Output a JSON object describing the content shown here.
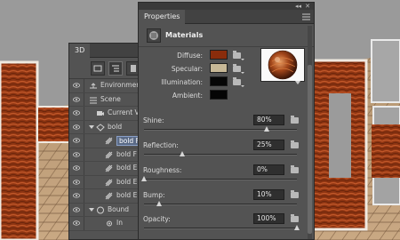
{
  "panel3d": {
    "tab_label": "3D",
    "tree": [
      {
        "label": "Environment",
        "icon": "environment-icon",
        "indent": 0
      },
      {
        "label": "Scene",
        "icon": "scene-icon",
        "indent": 0
      },
      {
        "label": "Current V",
        "icon": "camera-icon",
        "indent": 1
      },
      {
        "label": "bold",
        "icon": "mesh-icon",
        "indent": 1,
        "expanded": true
      },
      {
        "label": "bold F",
        "icon": "material-icon",
        "indent": 2,
        "selected": true
      },
      {
        "label": "bold F",
        "icon": "material-icon",
        "indent": 2
      },
      {
        "label": "bold E",
        "icon": "material-icon",
        "indent": 2
      },
      {
        "label": "bold E",
        "icon": "material-icon",
        "indent": 2
      },
      {
        "label": "bold E",
        "icon": "material-icon",
        "indent": 2
      },
      {
        "label": "Bound",
        "icon": "bounding-icon",
        "indent": 1,
        "expanded": true
      },
      {
        "label": "In",
        "icon": "infinite-light-icon",
        "indent": 2
      }
    ]
  },
  "properties": {
    "tab_label": "Properties",
    "section_title": "Materials",
    "swatches": [
      {
        "label": "Diffuse:",
        "color": "#8a2c0b"
      },
      {
        "label": "Specular:",
        "color": "#c7b896"
      },
      {
        "label": "Illumination:",
        "color": "#060606"
      },
      {
        "label": "Ambient:",
        "color": "#050505"
      }
    ],
    "props": [
      {
        "label": "Shine:",
        "value": "80%",
        "level": 0.8
      },
      {
        "label": "Reflection:",
        "value": "25%",
        "level": 0.25
      },
      {
        "label": "Roughness:",
        "value": "0%",
        "level": 0.0
      },
      {
        "label": "Bump:",
        "value": "10%",
        "level": 0.1
      },
      {
        "label": "Opacity:",
        "value": "100%",
        "level": 1.0
      }
    ]
  },
  "colors": {
    "panel_bg": "#535353",
    "wood": "#9a3a14",
    "tile": "#b9916a"
  }
}
